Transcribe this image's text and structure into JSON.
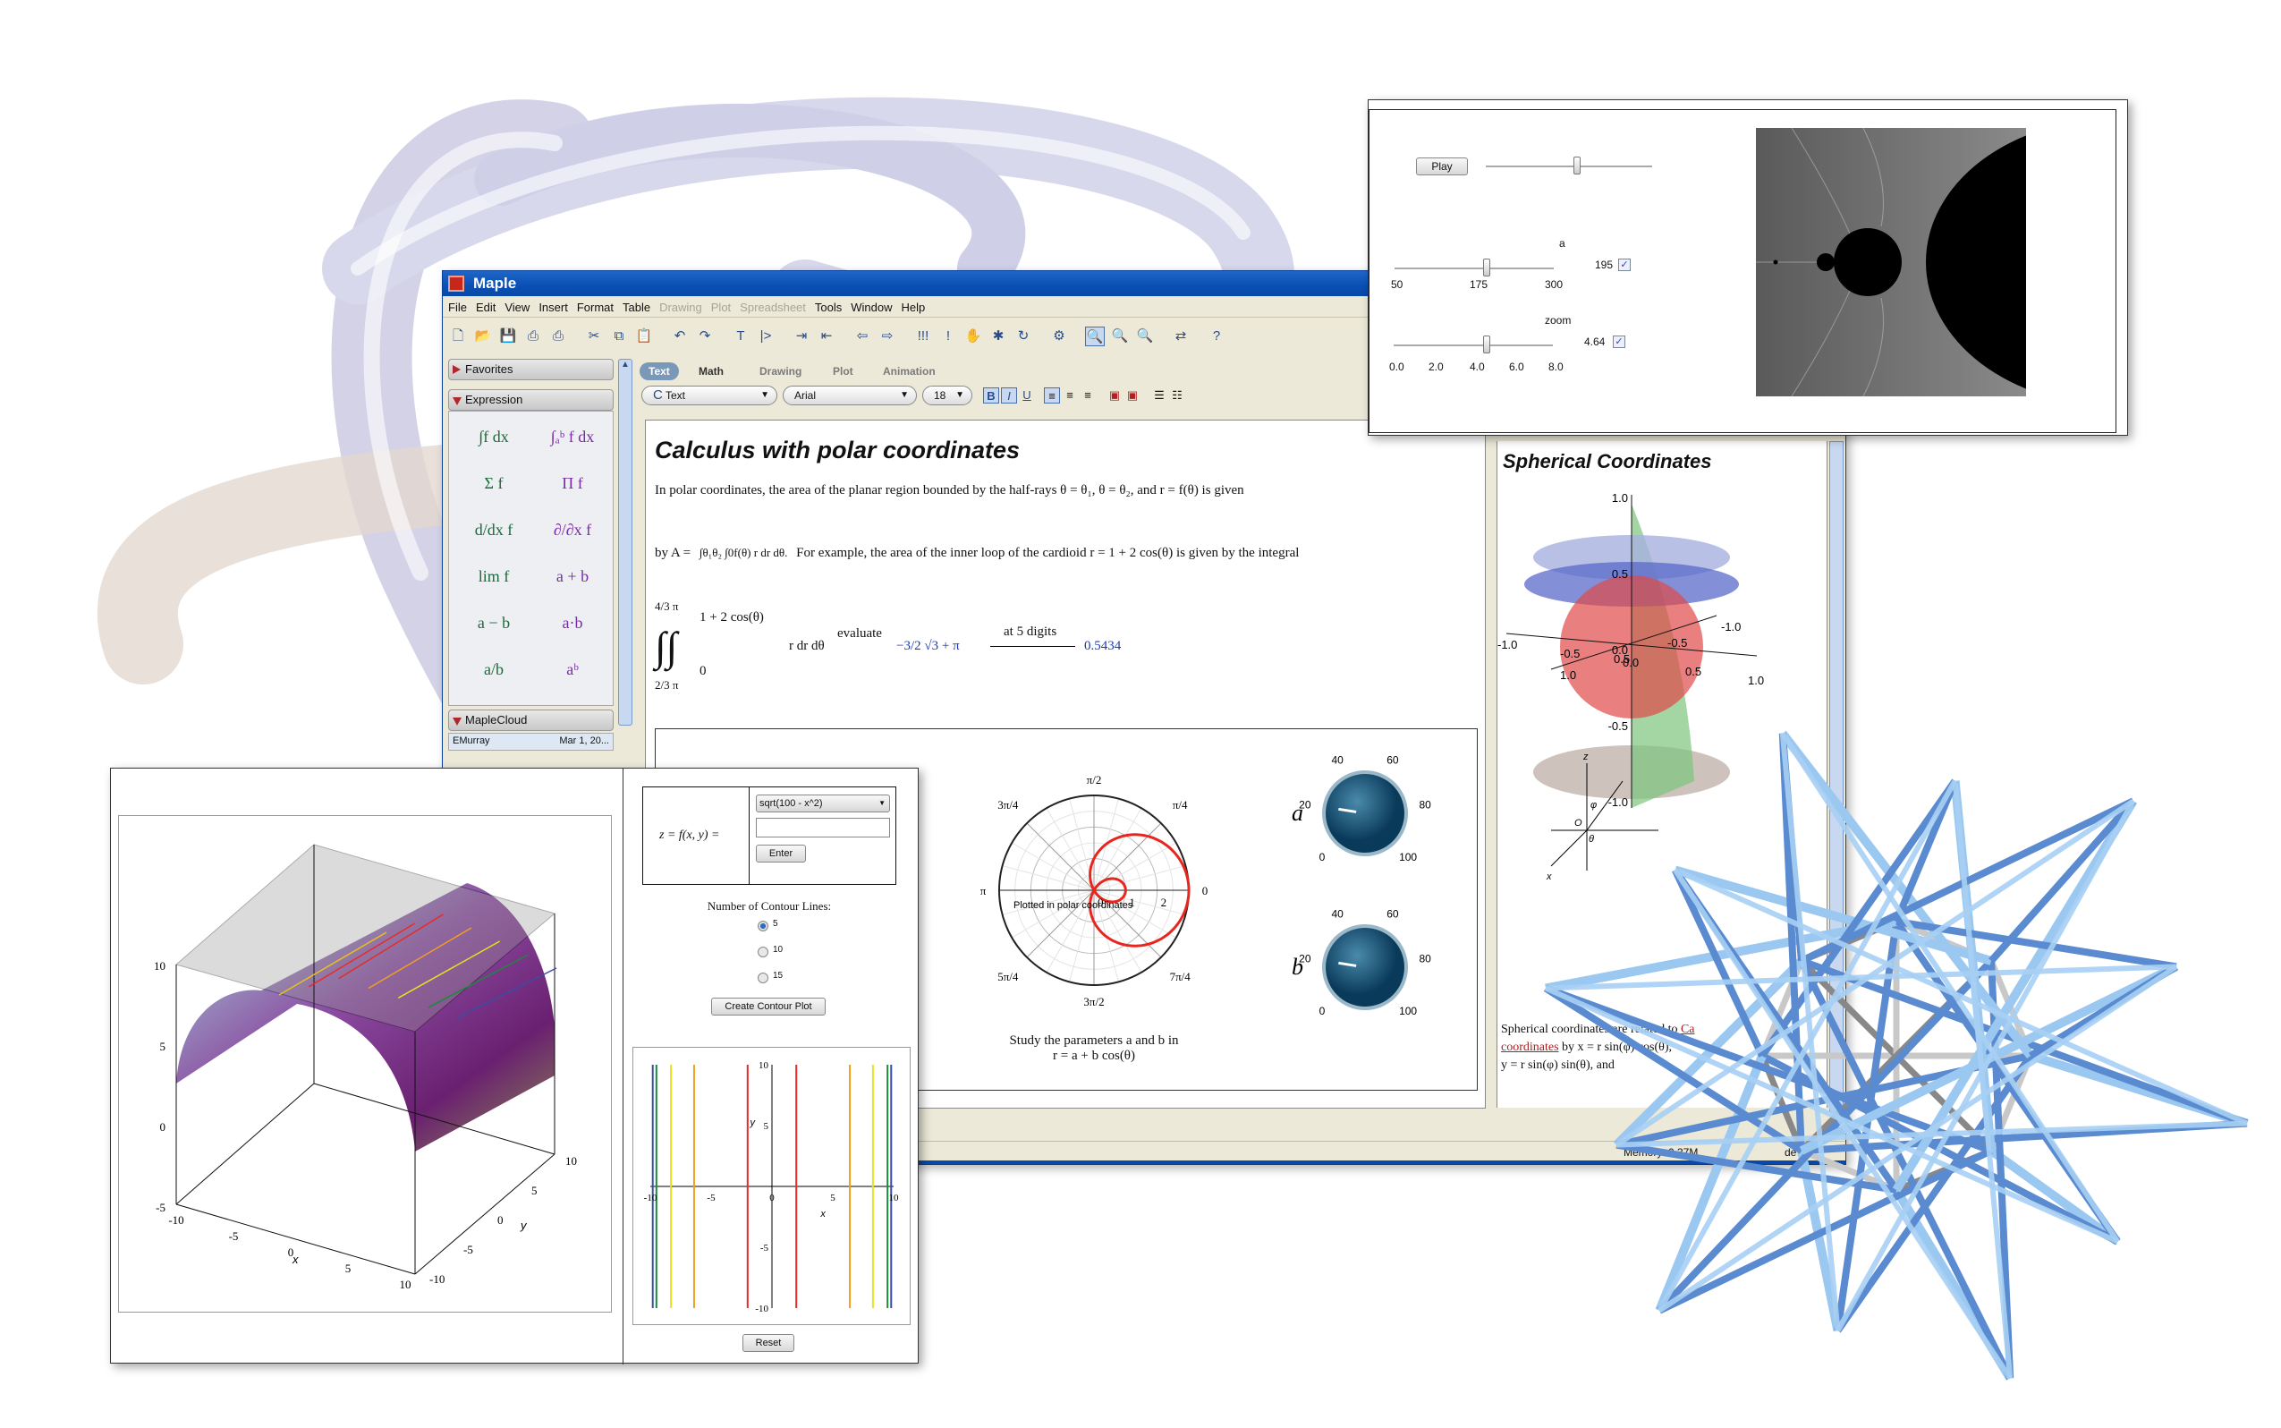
{
  "window": {
    "title": "Maple",
    "brand_color": "#0a4fb4"
  },
  "menu": [
    "File",
    "Edit",
    "View",
    "Insert",
    "Format",
    "Table",
    "Drawing",
    "Plot",
    "Spreadsheet",
    "Tools",
    "Window",
    "Help"
  ],
  "menu_disabled": [
    "Drawing",
    "Plot",
    "Spreadsheet"
  ],
  "toolbar": [
    "new-icon",
    "open-icon",
    "save-icon",
    "print-icon",
    "print-preview-icon",
    "cut-icon",
    "copy-icon",
    "paste-icon",
    "undo-icon",
    "redo-icon",
    "text-icon",
    "prompt-icon",
    "indent-icon",
    "outdent-icon",
    "back-icon",
    "forward-icon",
    "execute-all-icon",
    "execute-icon",
    "stop-icon",
    "debug-icon",
    "restart-icon",
    "settings-icon",
    "zoom-100-icon",
    "zoom-150-icon",
    "zoom-200-icon",
    "toggle-icon",
    "help-icon"
  ],
  "palettes": {
    "favorites": "Favorites",
    "expression": "Expression",
    "maplecloud": "MapleCloud",
    "cloud_user": "EMurray",
    "cloud_date": "Mar 1, 20...",
    "items": [
      "∫f dx",
      "∫ₐᵇ f dx",
      "Σ f",
      "Π f",
      "d/dx f",
      "∂/∂x f",
      "lim f",
      "a + b",
      "a − b",
      "a·b",
      "a/b",
      "aᵇ"
    ]
  },
  "context": {
    "tabs": [
      "Text",
      "Math",
      "Drawing",
      "Plot",
      "Animation"
    ],
    "active_tab": "Text",
    "style": "Text",
    "style_prefix": "C",
    "font": "Arial",
    "size": "18",
    "bold": "B",
    "italic": "I",
    "underline": "U"
  },
  "document": {
    "title": "Calculus with polar coordinates",
    "para1": "In polar coordinates, the area of the planar region bounded by the half-rays θ = θ₁, θ = θ₂, and r = f(θ) is given",
    "para2_prefix": "by A =",
    "para2_integral": "∫θ₁θ₂ ∫0f(θ) r dr dθ.",
    "para2_text": "For example, the area of the inner loop of the cardioid r = 1 + 2 cos(θ) is given by the integral",
    "int_upper": "4/3 π",
    "int_lower": "2/3 π",
    "inner_upper": "1 + 2 cos(θ)",
    "inner_lower": "0",
    "integrand": "r dr dθ",
    "evaluate_label": "evaluate",
    "exact_result": "−3/2 √3 + π",
    "digits_label": "at 5 digits",
    "numeric_result": "0.5434"
  },
  "polar_plot": {
    "angle_labels": [
      "π/2",
      "π/4",
      "0",
      "7π/4",
      "3π/2",
      "5π/4",
      "π",
      "3π/4"
    ],
    "radial_labels": [
      "0",
      "1",
      "2"
    ],
    "annotation": "Plotted in polar coordinates",
    "caption1": "Study the parameters a and b in",
    "caption2": "r = a + b cos(θ)",
    "curve_color": "#e8261e",
    "a": 1,
    "b": 2
  },
  "knobs": [
    {
      "label": "a",
      "ticks": [
        "0",
        "20",
        "40",
        "60",
        "80",
        "100"
      ],
      "value_fraction": 0.2
    },
    {
      "label": "b",
      "ticks": [
        "0",
        "20",
        "40",
        "60",
        "80",
        "100"
      ],
      "value_fraction": 0.2
    }
  ],
  "explore_panel": {
    "play": "Play",
    "animation_fraction": 0.55,
    "a_label": "a",
    "a_ticks": [
      "50",
      "175",
      "300"
    ],
    "a_value": "195",
    "zoom_label": "zoom",
    "zoom_ticks": [
      "0.0",
      "2.0",
      "4.0",
      "6.0",
      "8.0"
    ],
    "zoom_value": "4.64",
    "check": "✓"
  },
  "spherical": {
    "title": "Spherical Coordinates",
    "z_ticks": [
      "1.0",
      "0.5",
      "0.0",
      "-0.5",
      "-1.0"
    ],
    "x_ticks": [
      "-1.0",
      "-0.5",
      "0.0",
      "0.5",
      "1.0"
    ],
    "y_ticks": [
      "-1.0",
      "-0.5",
      "0.5",
      "1.0"
    ],
    "diagram_labels": [
      "z",
      "x",
      "φ",
      "θ",
      "O"
    ],
    "text1": "Spherical coordinates are related to",
    "link": "Ca",
    "text2_link": "coordinates",
    "text2": "by x = r sin(φ) cos(θ),",
    "text3": "y = r sin(φ) sin(θ), and"
  },
  "status": {
    "memory": "Memory: 0.37M",
    "mode": "de"
  },
  "contour_app": {
    "equation_label": "z = f(x, y) =",
    "function": "sqrt(100 - x^2)",
    "input": "",
    "enter": "Enter",
    "count_label": "Number of Contour Lines:",
    "options": [
      "5",
      "10",
      "15"
    ],
    "selected": "5",
    "create": "Create Contour Plot",
    "reset": "Reset"
  },
  "chart_data": [
    {
      "type": "surface",
      "function": "sqrt(100 - x^2)",
      "xlabel": "x",
      "ylabel": "y",
      "x_ticks": [
        "-10",
        "-5",
        "0",
        "5",
        "10"
      ],
      "y_ticks": [
        "-10",
        "-5",
        "0",
        "5",
        "10"
      ],
      "z_ticks": [
        "10",
        "5",
        "0",
        "-5"
      ],
      "xlim": [
        -10,
        10
      ],
      "ylim": [
        -10,
        10
      ],
      "zlim": [
        -10,
        10
      ]
    },
    {
      "type": "line",
      "title": "",
      "xlabel": "x",
      "ylabel": "y",
      "xlim": [
        -10,
        10
      ],
      "ylim": [
        -10,
        10
      ],
      "x_ticks": [
        "-10",
        "-5",
        "0",
        "5",
        "10"
      ],
      "y_ticks": [
        "10",
        "5",
        "-5",
        "-10"
      ],
      "series": [
        {
          "color": "#3a4ea8",
          "x": [
            -9.8,
            9.8
          ]
        },
        {
          "color": "#1a8a3a",
          "x": [
            -9.5,
            9.5
          ]
        },
        {
          "color": "#e8e020",
          "x": [
            -8.3,
            8.3
          ]
        },
        {
          "color": "#f0a020",
          "x": [
            -6.4,
            6.4
          ]
        },
        {
          "color": "#e82a2a",
          "x": [
            -2.0,
            2.0
          ]
        }
      ]
    }
  ]
}
